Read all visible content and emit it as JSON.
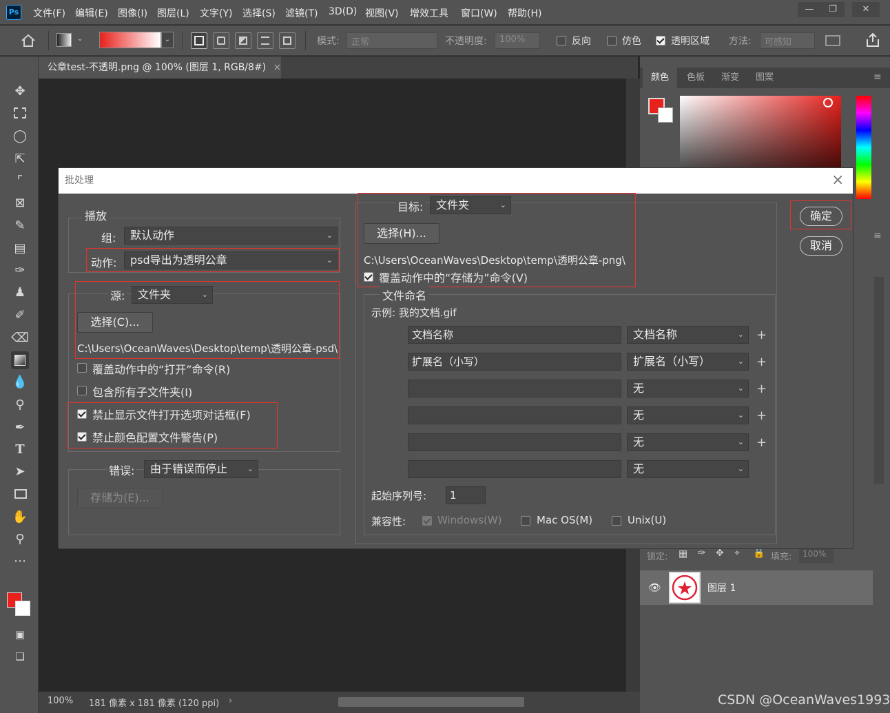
{
  "menubar": {
    "logo": "Ps",
    "items": [
      "文件(F)",
      "编辑(E)",
      "图像(I)",
      "图层(L)",
      "文字(Y)",
      "选择(S)",
      "滤镜(T)",
      "3D(D)",
      "视图(V)",
      "增效工具",
      "窗口(W)",
      "帮助(H)"
    ]
  },
  "options": {
    "mode_label": "模式:",
    "mode_value": "正常",
    "opacity_label": "不透明度:",
    "opacity_value": "100%",
    "reverse": "反向",
    "dither": "仿色",
    "transparency": "透明区域",
    "method_label": "方法:",
    "method_value": "可感知"
  },
  "document": {
    "tab_title": "公章test-不透明.png @ 100% (图层 1, RGB/8#)",
    "tab_close": "×",
    "zoom": "100%",
    "info": "181 像素 x 181 像素 (120 ppi)"
  },
  "panels": {
    "tabs": [
      "颜色",
      "色板",
      "渐变",
      "图案"
    ],
    "lock_label": "锁定:",
    "fill_label": "填充:",
    "fill_value": "100%",
    "layer_name": "图层 1"
  },
  "dialog": {
    "title": "批处理",
    "close": "×",
    "play": {
      "legend": "播放",
      "group_label": "组:",
      "group_value": "默认动作",
      "action_label": "动作:",
      "action_value": "psd导出为透明公章"
    },
    "source": {
      "label": "源:",
      "value": "文件夹",
      "choose_btn": "选择(C)...",
      "path": "C:\\Users\\OceanWaves\\Desktop\\temp\\透明公章-psd\\",
      "override_open": "覆盖动作中的“打开”命令(R)",
      "include_sub": "包含所有子文件夹(I)",
      "suppress_dialogs": "禁止显示文件打开选项对话框(F)",
      "suppress_color": "禁止颜色配置文件警告(P)"
    },
    "errors": {
      "label": "错误:",
      "value": "由于错误而停止",
      "save_btn": "存储为(E)..."
    },
    "target": {
      "label": "目标:",
      "value": "文件夹",
      "choose_btn": "选择(H)...",
      "path": "C:\\Users\\OceanWaves\\Desktop\\temp\\透明公章-png\\",
      "override_save": "覆盖动作中的“存储为”命令(V)"
    },
    "naming": {
      "legend": "文件命名",
      "example": "示例: 我的文档.gif",
      "rows": [
        {
          "text": "文档名称",
          "select": "文档名称"
        },
        {
          "text": "扩展名（小写）",
          "select": "扩展名（小写）"
        },
        {
          "text": "",
          "select": "无"
        },
        {
          "text": "",
          "select": "无"
        },
        {
          "text": "",
          "select": "无"
        },
        {
          "text": "",
          "select": "无"
        }
      ],
      "plus": "+",
      "serial_label": "起始序列号:",
      "serial_value": "1",
      "compat_label": "兼容性:",
      "windows": "Windows(W)",
      "macos": "Mac OS(M)",
      "unix": "Unix(U)"
    },
    "ok": "确定",
    "cancel": "取消"
  },
  "watermark": "CSDN @OceanWaves1993",
  "colors": {
    "foreground": "#e8211c",
    "highlight": "#e8332b"
  }
}
